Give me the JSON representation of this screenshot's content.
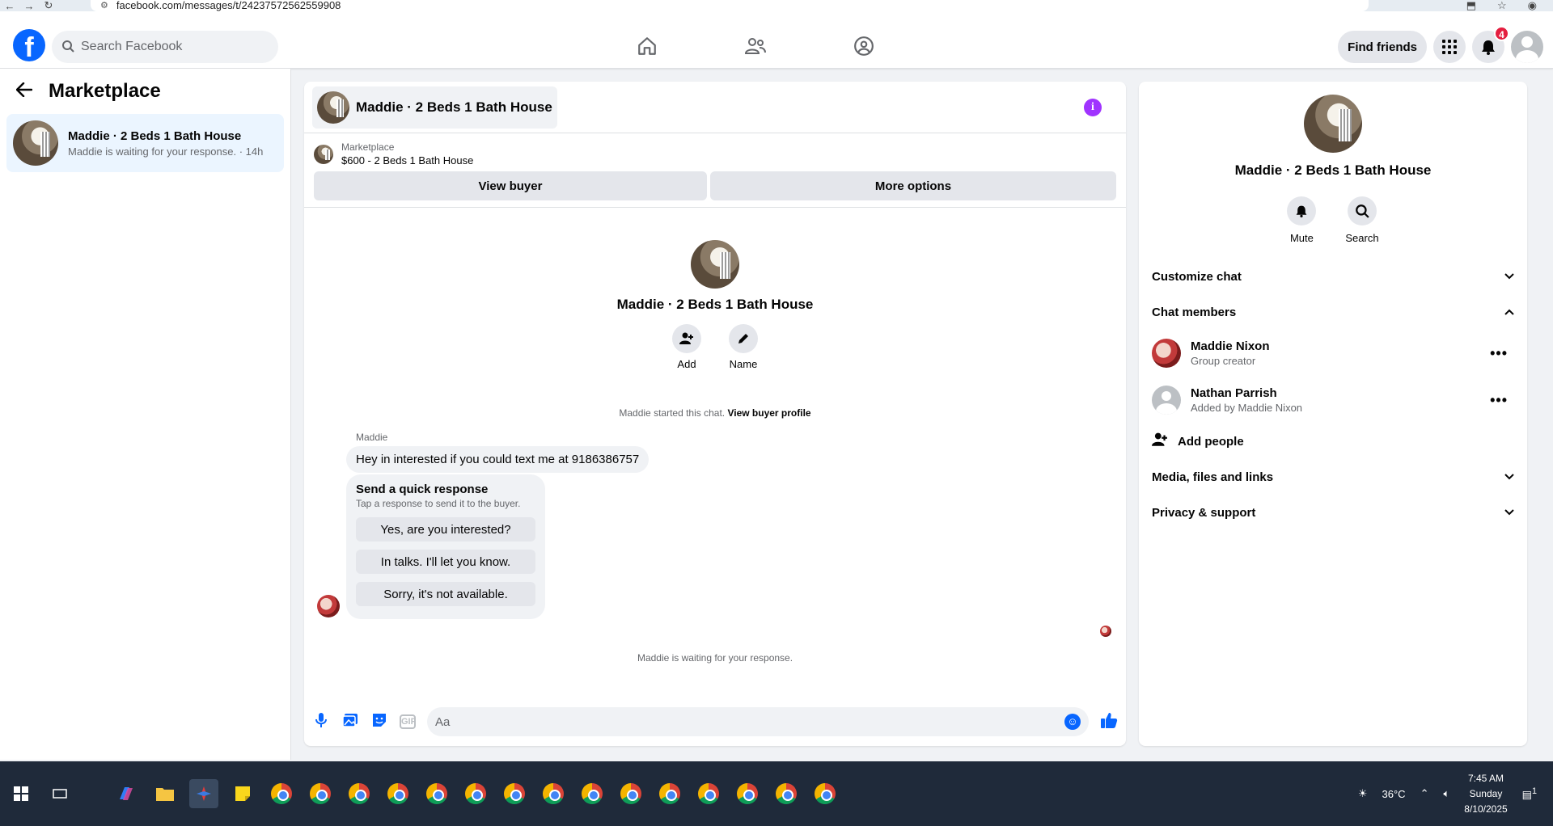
{
  "browser": {
    "url": "facebook.com/messages/t/24237572562559908"
  },
  "topbar": {
    "search_placeholder": "Search Facebook",
    "find_friends": "Find friends",
    "notif_count": "4"
  },
  "sidebar": {
    "title": "Marketplace",
    "conversation": {
      "title": "Maddie · 2 Beds 1 Bath House",
      "subtitle": "Maddie is waiting for your response. · 14h"
    }
  },
  "chat": {
    "title": "Maddie · 2 Beds 1 Bath House",
    "listing": {
      "category": "Marketplace",
      "price_title": "$600 - 2 Beds 1 Bath House"
    },
    "view_buyer": "View buyer",
    "more_options": "More options",
    "intro_title": "Maddie · 2 Beds 1 Bath House",
    "add_label": "Add",
    "name_label": "Name",
    "started_text": "Maddie started this chat.",
    "view_buyer_profile": "View buyer profile",
    "sender": "Maddie",
    "message": "Hey in interested if you could text me at 9186386757",
    "quick": {
      "title": "Send a quick response",
      "subtitle": "Tap a response to send it to the buyer.",
      "options": [
        "Yes, are you interested?",
        "In talks. I'll let you know.",
        "Sorry, it's not available."
      ]
    },
    "waiting": "Maddie is waiting for your response.",
    "input_placeholder": "Aa"
  },
  "details": {
    "title": "Maddie · 2 Beds 1 Bath House",
    "mute": "Mute",
    "search": "Search",
    "customize": "Customize chat",
    "members_header": "Chat members",
    "members": [
      {
        "name": "Maddie Nixon",
        "role": "Group creator"
      },
      {
        "name": "Nathan Parrish",
        "role": "Added by Maddie Nixon"
      }
    ],
    "add_people": "Add people",
    "media": "Media, files and links",
    "privacy": "Privacy & support"
  },
  "taskbar": {
    "temp": "36°C",
    "time": "7:45 AM",
    "day": "Sunday",
    "date": "8/10/2025",
    "chat_count": "1"
  },
  "colors": {
    "accent": "#0866ff",
    "info": "#a033ff",
    "badge": "#e41e3f"
  }
}
